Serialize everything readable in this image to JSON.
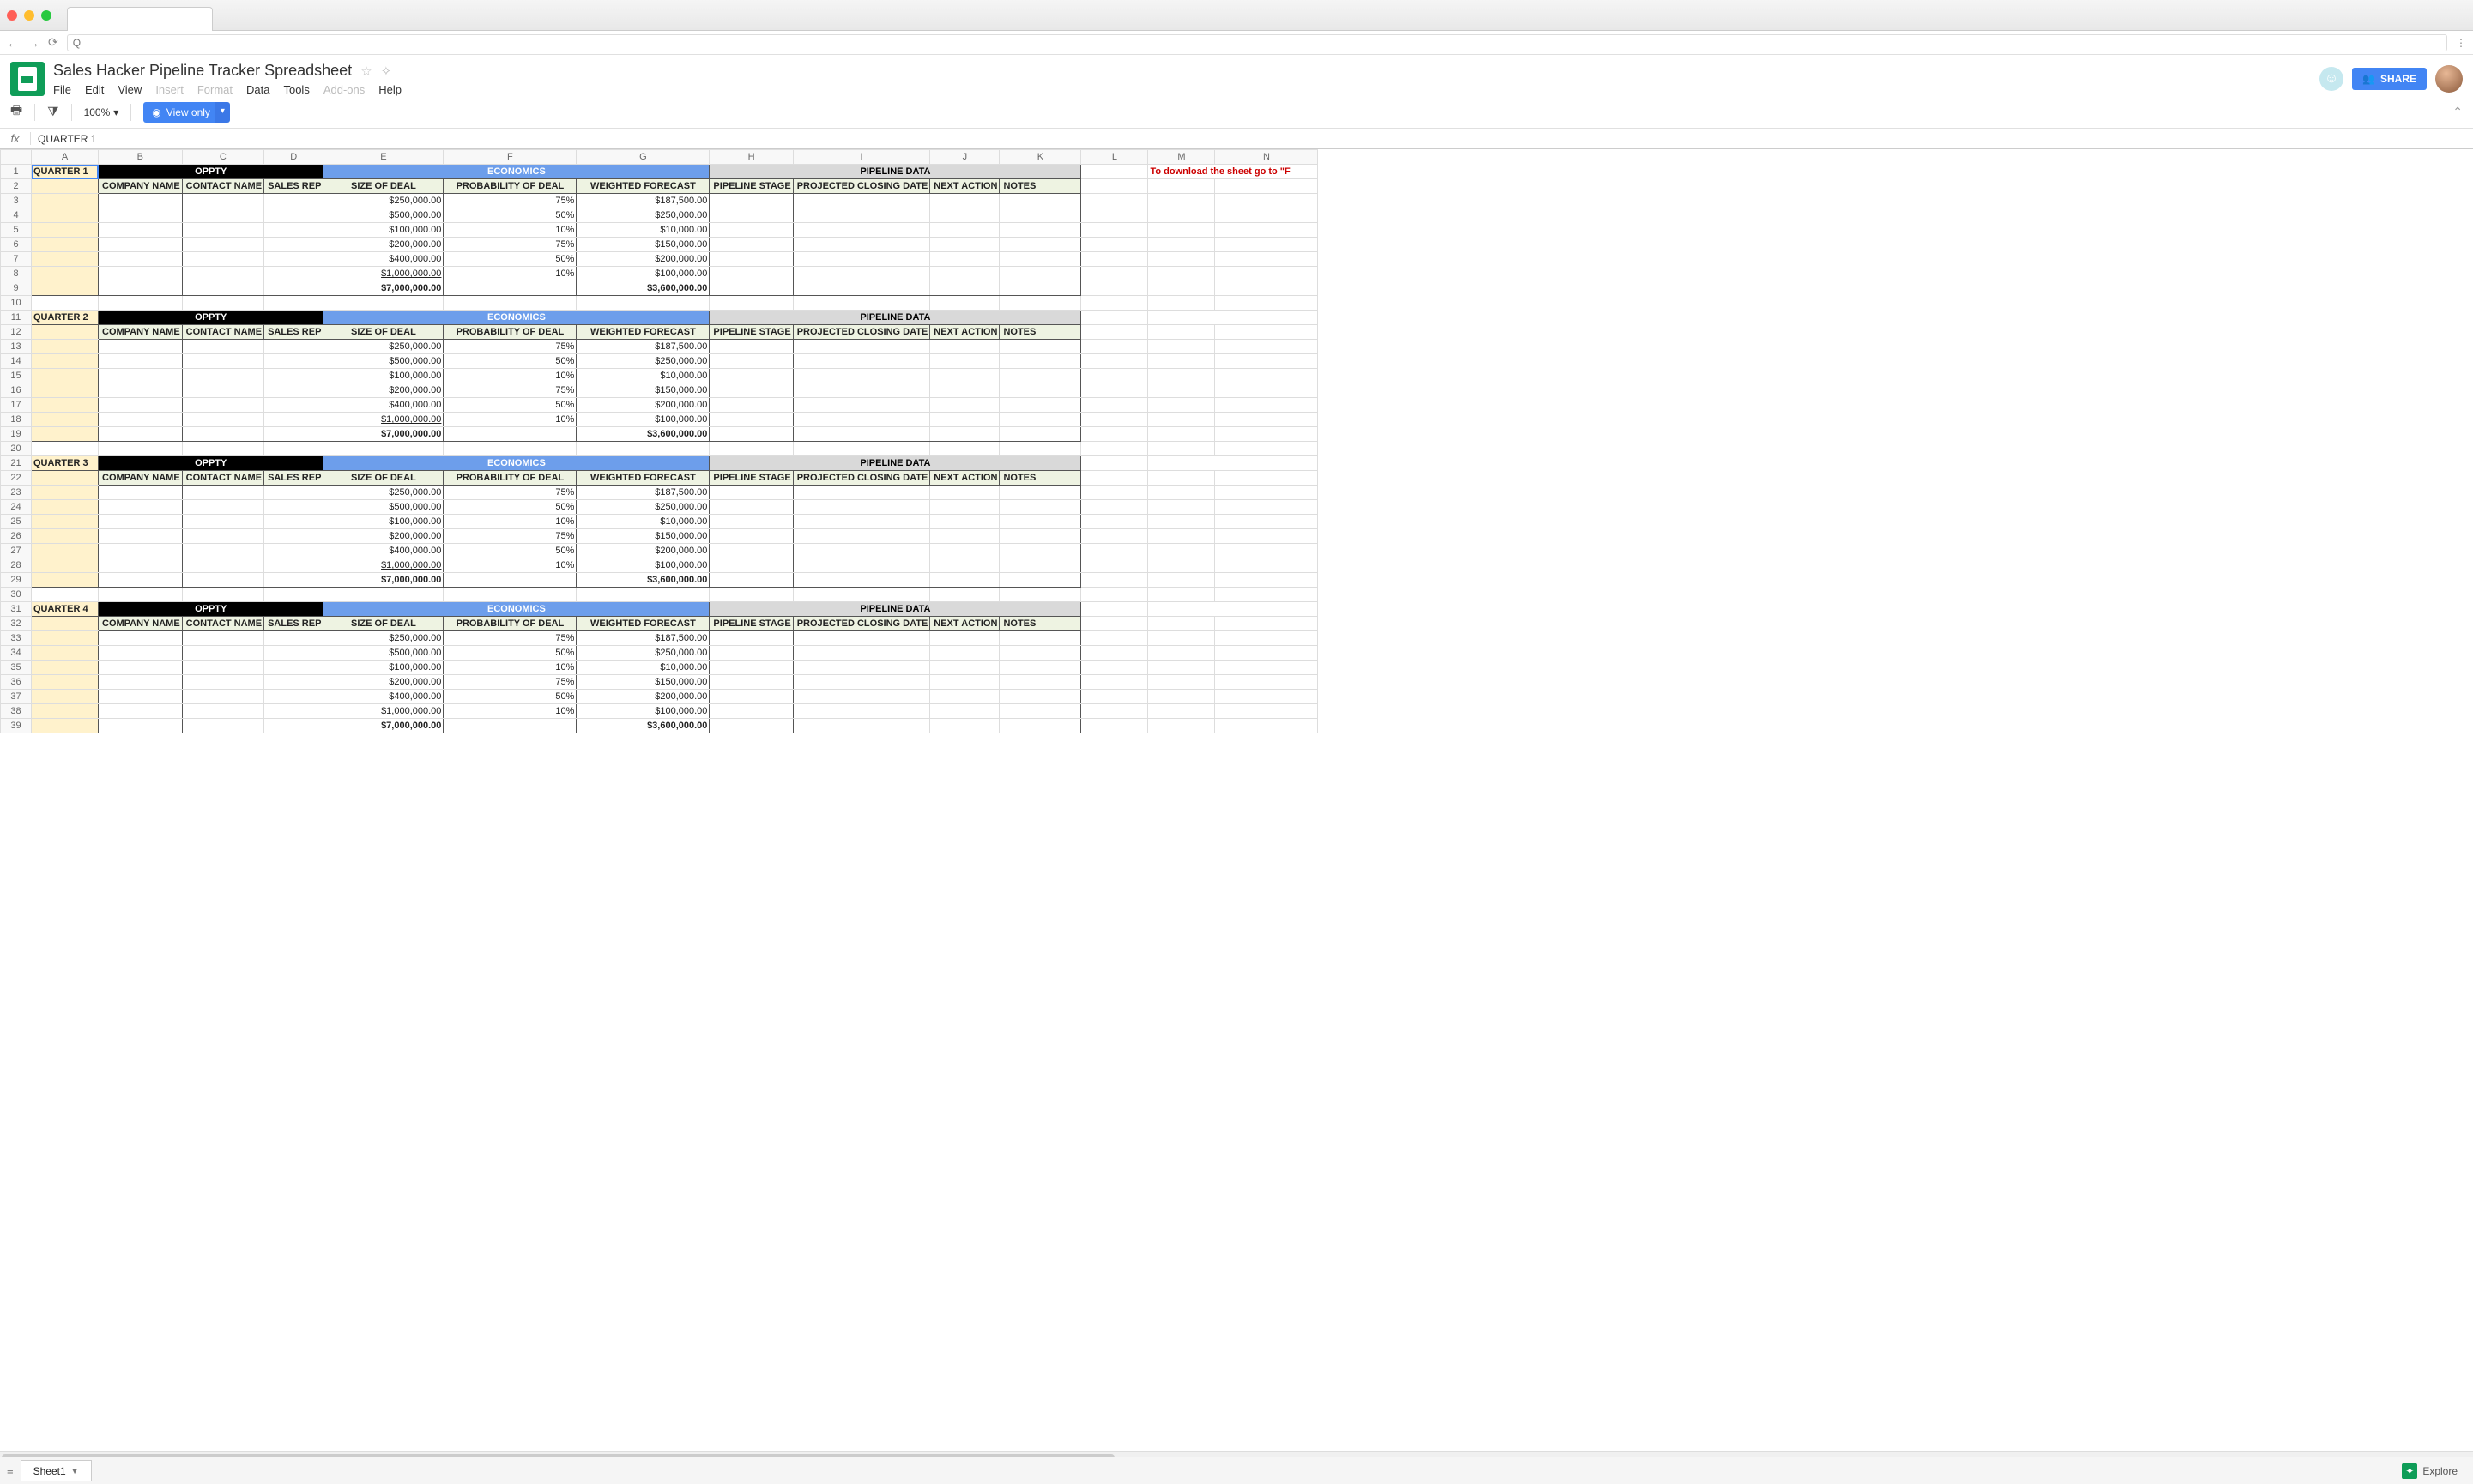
{
  "browser": {
    "url_prefix": "Q"
  },
  "doc": {
    "title": "Sales Hacker Pipeline Tracker Spreadsheet",
    "menus": [
      "File",
      "Edit",
      "View",
      "Insert",
      "Format",
      "Data",
      "Tools",
      "Add-ons",
      "Help"
    ],
    "menus_dim": [
      "Insert",
      "Format",
      "Add-ons"
    ]
  },
  "toolbar": {
    "zoom": "100%",
    "view_only": "View only"
  },
  "share": {
    "label": "SHARE"
  },
  "formula_bar": {
    "fx": "fx",
    "value": "QUARTER 1"
  },
  "columns": [
    "A",
    "B",
    "C",
    "D",
    "E",
    "F",
    "G",
    "H",
    "I",
    "J",
    "K",
    "L",
    "M",
    "N"
  ],
  "section_headers": {
    "oppty": "OPPTY",
    "economics": "ECONOMICS",
    "pipeline": "PIPELINE DATA"
  },
  "sub_headers": {
    "company": "COMPANY NAME",
    "contact": "CONTACT NAME",
    "rep": "SALES REP",
    "size": "SIZE OF DEAL",
    "prob": "PROBABILITY OF DEAL",
    "forecast": "WEIGHTED FORECAST",
    "stage": "PIPELINE STAGE",
    "closing": "PROJECTED CLOSING DATE",
    "next": "NEXT ACTION",
    "notes": "NOTES"
  },
  "note": "To download the sheet go to \"F",
  "quarters": [
    {
      "label": "QUARTER 1",
      "rows": [
        {
          "size": "$250,000.00",
          "prob": "75%",
          "forecast": "$187,500.00"
        },
        {
          "size": "$500,000.00",
          "prob": "50%",
          "forecast": "$250,000.00"
        },
        {
          "size": "$100,000.00",
          "prob": "10%",
          "forecast": "$10,000.00"
        },
        {
          "size": "$200,000.00",
          "prob": "75%",
          "forecast": "$150,000.00"
        },
        {
          "size": "$400,000.00",
          "prob": "50%",
          "forecast": "$200,000.00"
        },
        {
          "size": "$1,000,000.00",
          "prob": "10%",
          "forecast": "$100,000.00"
        }
      ],
      "total": {
        "size": "$7,000,000.00",
        "forecast": "$3,600,000.00"
      }
    },
    {
      "label": "QUARTER 2",
      "rows": [
        {
          "size": "$250,000.00",
          "prob": "75%",
          "forecast": "$187,500.00"
        },
        {
          "size": "$500,000.00",
          "prob": "50%",
          "forecast": "$250,000.00"
        },
        {
          "size": "$100,000.00",
          "prob": "10%",
          "forecast": "$10,000.00"
        },
        {
          "size": "$200,000.00",
          "prob": "75%",
          "forecast": "$150,000.00"
        },
        {
          "size": "$400,000.00",
          "prob": "50%",
          "forecast": "$200,000.00"
        },
        {
          "size": "$1,000,000.00",
          "prob": "10%",
          "forecast": "$100,000.00"
        }
      ],
      "total": {
        "size": "$7,000,000.00",
        "forecast": "$3,600,000.00"
      }
    },
    {
      "label": "QUARTER 3",
      "rows": [
        {
          "size": "$250,000.00",
          "prob": "75%",
          "forecast": "$187,500.00"
        },
        {
          "size": "$500,000.00",
          "prob": "50%",
          "forecast": "$250,000.00"
        },
        {
          "size": "$100,000.00",
          "prob": "10%",
          "forecast": "$10,000.00"
        },
        {
          "size": "$200,000.00",
          "prob": "75%",
          "forecast": "$150,000.00"
        },
        {
          "size": "$400,000.00",
          "prob": "50%",
          "forecast": "$200,000.00"
        },
        {
          "size": "$1,000,000.00",
          "prob": "10%",
          "forecast": "$100,000.00"
        }
      ],
      "total": {
        "size": "$7,000,000.00",
        "forecast": "$3,600,000.00"
      }
    },
    {
      "label": "QUARTER 4",
      "rows": [
        {
          "size": "$250,000.00",
          "prob": "75%",
          "forecast": "$187,500.00"
        },
        {
          "size": "$500,000.00",
          "prob": "50%",
          "forecast": "$250,000.00"
        },
        {
          "size": "$100,000.00",
          "prob": "10%",
          "forecast": "$10,000.00"
        },
        {
          "size": "$200,000.00",
          "prob": "75%",
          "forecast": "$150,000.00"
        },
        {
          "size": "$400,000.00",
          "prob": "50%",
          "forecast": "$200,000.00"
        },
        {
          "size": "$1,000,000.00",
          "prob": "10%",
          "forecast": "$100,000.00"
        }
      ],
      "total": {
        "size": "$7,000,000.00",
        "forecast": "$3,600,000.00"
      }
    }
  ],
  "sheet_tab": "Sheet1",
  "explore": "Explore"
}
